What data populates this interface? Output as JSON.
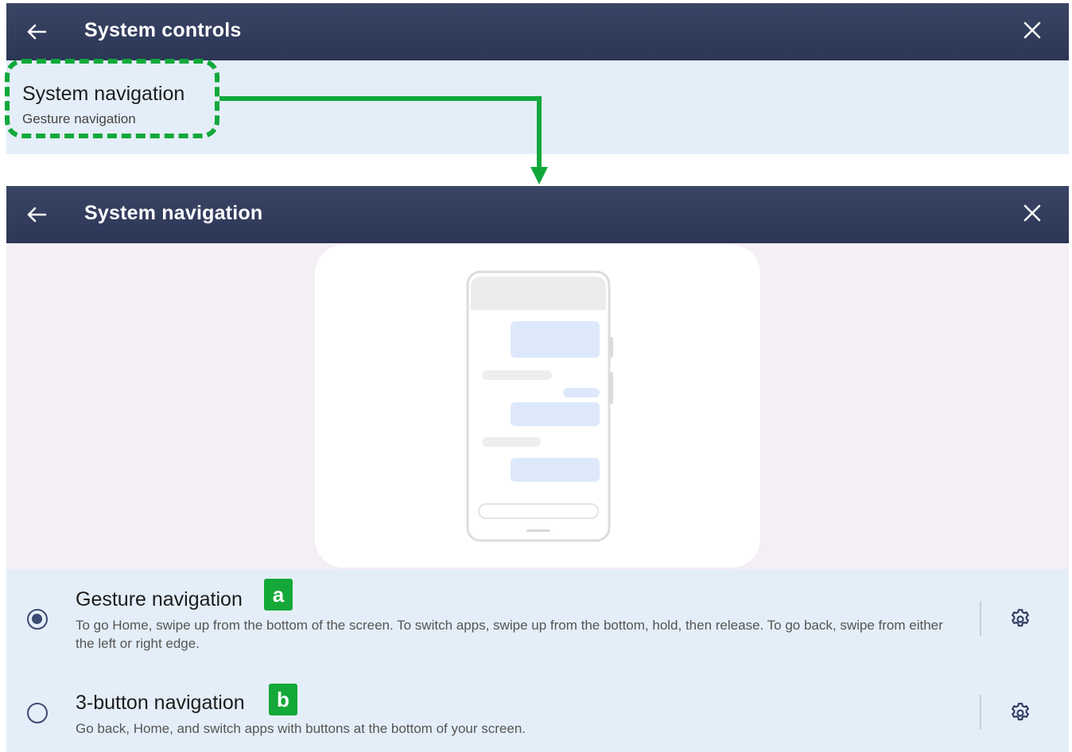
{
  "screen1": {
    "header": {
      "title": "System controls"
    },
    "item": {
      "title": "System navigation",
      "subtitle": "Gesture navigation"
    }
  },
  "screen2": {
    "header": {
      "title": "System navigation"
    },
    "options": [
      {
        "label": "Gesture navigation",
        "description": "To go Home, swipe up from the bottom of the screen. To switch apps, swipe up from the bottom, hold, then release. To go back, swipe from either the left or right edge.",
        "selected": true,
        "badge": "a"
      },
      {
        "label": "3-button navigation",
        "description": "Go back, Home, and switch apps with buttons at the bottom of your screen.",
        "selected": false,
        "badge": "b"
      }
    ]
  },
  "colors": {
    "appbar": "#2c3656",
    "highlight": "#11a83b",
    "panel": "#e4eef8",
    "preview_bg": "#f3eff4"
  },
  "icons": [
    "back-arrow-icon",
    "close-icon",
    "gear-icon",
    "radio-selected-icon",
    "radio-unselected-icon",
    "phone-illustration"
  ]
}
